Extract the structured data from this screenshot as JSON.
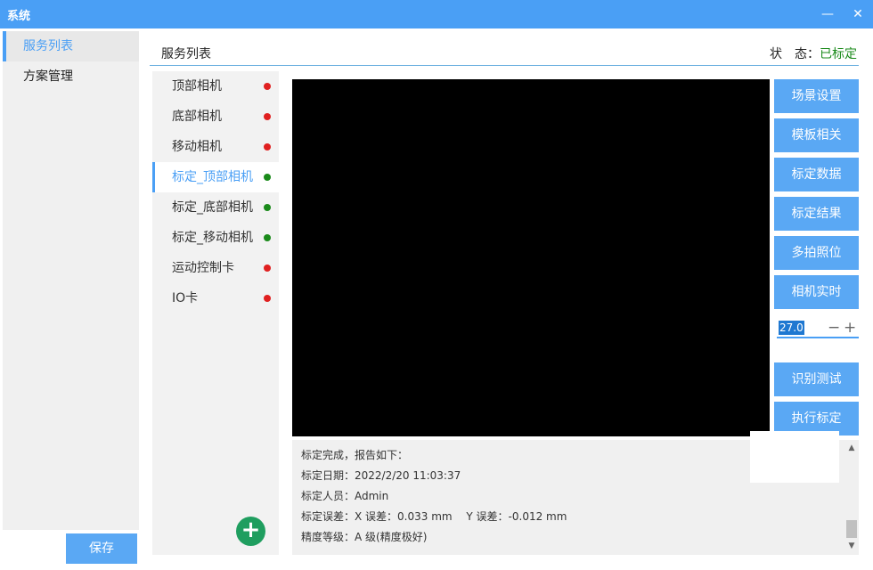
{
  "window": {
    "title": "系统",
    "minimize": "—",
    "close": "✕"
  },
  "nav": {
    "items": [
      {
        "label": "服务列表",
        "active": true
      },
      {
        "label": "方案管理",
        "active": false
      }
    ],
    "save_label": "保存"
  },
  "header": {
    "title": "服务列表",
    "status_label": "状　态：",
    "status_value": "已标定"
  },
  "colors": {
    "accent": "#4a9ff5",
    "ok": "#1a8a1a",
    "error": "#e02020",
    "add": "#1f9e5f"
  },
  "services": [
    {
      "label": "顶部相机",
      "status": "red",
      "active": false
    },
    {
      "label": "底部相机",
      "status": "red",
      "active": false
    },
    {
      "label": "移动相机",
      "status": "red",
      "active": false
    },
    {
      "label": "标定_顶部相机",
      "status": "green",
      "active": true
    },
    {
      "label": "标定_底部相机",
      "status": "green",
      "active": false
    },
    {
      "label": "标定_移动相机",
      "status": "green",
      "active": false
    },
    {
      "label": "运动控制卡",
      "status": "red",
      "active": false
    },
    {
      "label": "IO卡",
      "status": "red",
      "active": false
    }
  ],
  "add_button": {
    "icon": "plus-icon",
    "glyph": "+"
  },
  "side_buttons": [
    "场景设置",
    "模板相关",
    "标定数据",
    "标定结果",
    "多拍照位",
    "相机实时"
  ],
  "value_input": {
    "value": "27.0",
    "minus": "−",
    "plus": "+"
  },
  "side_buttons_bottom": [
    "识别测试",
    "执行标定"
  ],
  "report": [
    "标定完成，报告如下：",
    "标定日期：2022/2/20 11:03:37",
    "标定人员：Admin",
    "标定误差：X 误差：0.033 mm　 Y 误差：-0.012 mm",
    "精度等级：A 级(精度极好)"
  ],
  "scroll": {
    "up": "▲",
    "down": "▼"
  }
}
